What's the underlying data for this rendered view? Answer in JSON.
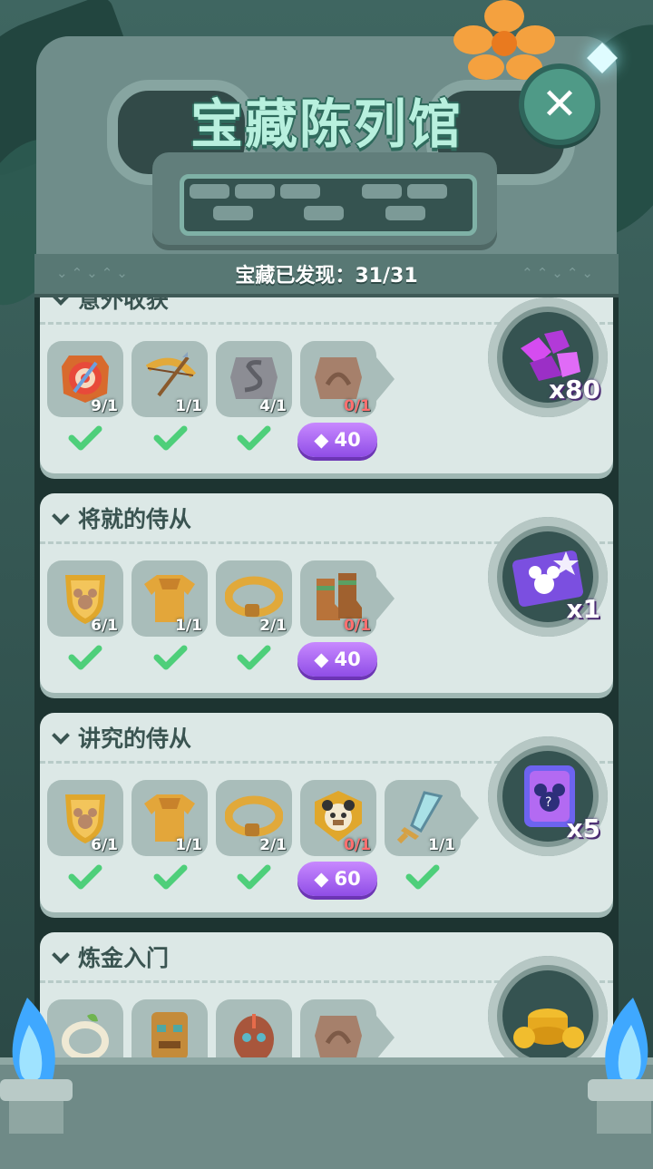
{
  "title": "宝藏陈列馆",
  "close_label": "✕",
  "discovered_counter": "宝藏已发现：31/31",
  "sections": [
    {
      "title": "意外收获",
      "items": [
        {
          "icon": "target-badge-icon",
          "count": "9/1",
          "status": "complete"
        },
        {
          "icon": "bow-arrow-icon",
          "count": "1/1",
          "status": "complete"
        },
        {
          "icon": "stone-serpent-icon",
          "count": "4/1",
          "status": "complete"
        },
        {
          "icon": "stone-tablet-icon",
          "count": "0/1",
          "status": "buy",
          "price": "40"
        }
      ],
      "reward": {
        "icon": "purple-gems-icon",
        "quantity": "x80"
      }
    },
    {
      "title": "将就的侍从",
      "items": [
        {
          "icon": "mickey-shield-icon",
          "count": "6/1",
          "status": "complete"
        },
        {
          "icon": "golden-armor-icon",
          "count": "1/1",
          "status": "complete"
        },
        {
          "icon": "golden-belt-icon",
          "count": "2/1",
          "status": "complete"
        },
        {
          "icon": "leather-boots-icon",
          "count": "0/1",
          "status": "buy",
          "price": "40"
        }
      ],
      "reward": {
        "icon": "mickey-ticket-icon",
        "quantity": "x1"
      }
    },
    {
      "title": "讲究的侍从",
      "items": [
        {
          "icon": "mickey-shield-icon",
          "count": "6/1",
          "status": "complete"
        },
        {
          "icon": "golden-armor-icon",
          "count": "1/1",
          "status": "complete"
        },
        {
          "icon": "golden-belt-icon",
          "count": "2/1",
          "status": "complete"
        },
        {
          "icon": "panda-shield-icon",
          "count": "0/1",
          "status": "buy",
          "price": "60"
        },
        {
          "icon": "crystal-sword-icon",
          "count": "1/1",
          "status": "complete"
        }
      ],
      "reward": {
        "icon": "mystery-card-icon",
        "quantity": "x5"
      }
    },
    {
      "title": "炼金入门",
      "items": [
        {
          "icon": "rope-ring-icon"
        },
        {
          "icon": "tiki-mask-icon"
        },
        {
          "icon": "tribal-mask-icon"
        },
        {
          "icon": "stone-tablet-icon"
        }
      ],
      "reward": {
        "icon": "gold-coins-icon"
      }
    }
  ]
}
